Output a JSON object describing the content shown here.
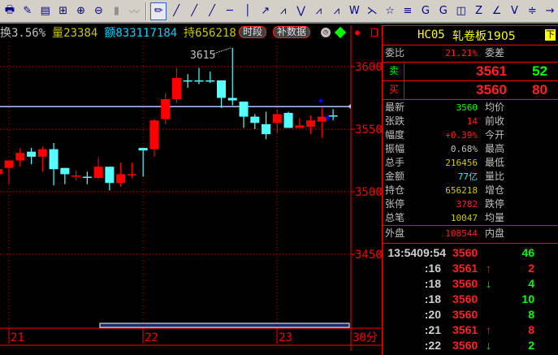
{
  "toolbar": {
    "icons": [
      "print-icon",
      "notes-icon",
      "book-icon",
      "tree-icon",
      "zoom-in-icon",
      "zoom-out-icon",
      "candle-icon",
      "line-icon",
      "pencil-icon",
      "segment-icon",
      "line-segment-icon",
      "ray-icon",
      "horizontal-line-icon",
      "vertical-line-icon",
      "arrow-icon",
      "polyline-icon",
      "wave-icon",
      "zigzag-icon",
      "zigzag2-icon",
      "w-pattern-icon",
      "fork-icon",
      "star-icon",
      "parallel-icon",
      "gann-icon",
      "gann2-icon",
      "box-icon",
      "z-icon",
      "fan-icon",
      "v-icon",
      "channel-icon",
      "more-icon"
    ]
  },
  "infobar": {
    "turnover": "换3.56%",
    "volume_label": "量",
    "volume": "23384",
    "amount_label": "额",
    "amount": "833117184",
    "oi_label": "持",
    "oi": "656218",
    "period_button": "时段",
    "fill_data_button": "补数据"
  },
  "quote": {
    "code": "HC05",
    "name": "轧卷板1905",
    "down_badge": "下",
    "weibi_label": "委比",
    "weibi": "21.21%",
    "weicha_label": "委差",
    "sell_label": "卖",
    "sell_price": "3561",
    "sell_vol": "52",
    "buy_label": "买",
    "buy_price": "3560",
    "buy_vol": "80",
    "rows": [
      {
        "l": "最新",
        "v": "3560",
        "c": "#00ff00",
        "r": "均价"
      },
      {
        "l": "张跌",
        "v": "14",
        "c": "#ff2020",
        "r": "前收"
      },
      {
        "l": "幅度",
        "v": "+0.39%",
        "c": "#ff2020",
        "r": "今开"
      },
      {
        "l": "振幅",
        "v": "0.68%",
        "c": "#c0c0c0",
        "r": "最高"
      },
      {
        "l": "总手",
        "v": "216456",
        "c": "#c8c800",
        "r": "最低"
      },
      {
        "l": "金额",
        "v": "77亿",
        "c": "#00ffff",
        "r": "量比"
      },
      {
        "l": "持仓",
        "v": "656218",
        "c": "#c8c800",
        "r": "增仓"
      },
      {
        "l": "张停",
        "v": "3782",
        "c": "#ff2020",
        "r": "跌停"
      },
      {
        "l": "总笔",
        "v": "10047",
        "c": "#c8c800",
        "r": "均量"
      }
    ],
    "outer_label": "外盘",
    "outer": "108544",
    "inner_label": "内盘"
  },
  "ticks": [
    {
      "t": "13:5409:54",
      "p": "3560",
      "a": "",
      "v": "46",
      "vc": "#00ff00"
    },
    {
      "t": ":16",
      "p": "3561",
      "a": "↑",
      "ac": "#ff2020",
      "v": "2",
      "vc": "#ff2020"
    },
    {
      "t": ":18",
      "p": "3560",
      "a": "↓",
      "ac": "#00ff00",
      "v": "4",
      "vc": "#00ff00"
    },
    {
      "t": ":18",
      "p": "3560",
      "a": "",
      "v": "10",
      "vc": "#00ff00"
    },
    {
      "t": ":20",
      "p": "3560",
      "a": "",
      "v": "8",
      "vc": "#00ff00"
    },
    {
      "t": ":21",
      "p": "3561",
      "a": "↑",
      "ac": "#ff2020",
      "v": "8",
      "vc": "#ff2020"
    },
    {
      "t": ":22",
      "p": "3560",
      "a": "↓",
      "ac": "#00ff00",
      "v": "2",
      "vc": "#00ff00"
    }
  ],
  "chart_data": {
    "type": "candlestick",
    "period_label": "30分",
    "x_labels": [
      "21",
      "22",
      "23"
    ],
    "y_ticks": [
      "3600",
      "3550",
      "3500",
      "3450"
    ],
    "ylim": [
      3415,
      3655
    ],
    "high_annotation": "3615",
    "ref_line_price": 3568,
    "up_color": "#ff0000",
    "down_color": "#54ffff",
    "candles": [
      [
        3514,
        3518,
        3519,
        3512
      ],
      [
        3519,
        3525,
        3525,
        3506
      ],
      [
        3525,
        3531,
        3535,
        3520
      ],
      [
        3532,
        3528,
        3535,
        3522
      ],
      [
        3528,
        3534,
        3536,
        3516
      ],
      [
        3534,
        3518,
        3539,
        3505
      ],
      [
        3519,
        3514,
        3519,
        3506
      ],
      [
        3513,
        3513,
        3517,
        3509
      ],
      [
        3512,
        3512,
        3516,
        3506
      ],
      [
        3511,
        3520,
        3527,
        3510
      ],
      [
        3520,
        3507,
        3520,
        3501
      ],
      [
        3507,
        3514,
        3523,
        3504
      ],
      [
        3514,
        3514,
        3523,
        3511
      ],
      [
        3535,
        3533,
        3535,
        3512
      ],
      [
        3534,
        3557,
        3558,
        3528
      ],
      [
        3558,
        3574,
        3579,
        3554
      ],
      [
        3574,
        3591,
        3599,
        3571
      ],
      [
        3589,
        3589,
        3594,
        3583
      ],
      [
        3589,
        3589,
        3599,
        3586
      ],
      [
        3589,
        3589,
        3596,
        3587
      ],
      [
        3589,
        3575,
        3589,
        3567
      ],
      [
        3575,
        3573,
        3615,
        3569
      ],
      [
        3572,
        3560,
        3572,
        3551
      ],
      [
        3560,
        3555,
        3562,
        3550
      ],
      [
        3554,
        3546,
        3564,
        3542
      ],
      [
        3555,
        3562,
        3566,
        3547
      ],
      [
        3563,
        3551,
        3564,
        3551
      ],
      [
        3551,
        3553,
        3559,
        3551
      ],
      [
        3552,
        3557,
        3561,
        3546
      ],
      [
        3556,
        3560,
        3567,
        3543
      ],
      [
        3561,
        3561,
        3566,
        3557
      ]
    ]
  }
}
